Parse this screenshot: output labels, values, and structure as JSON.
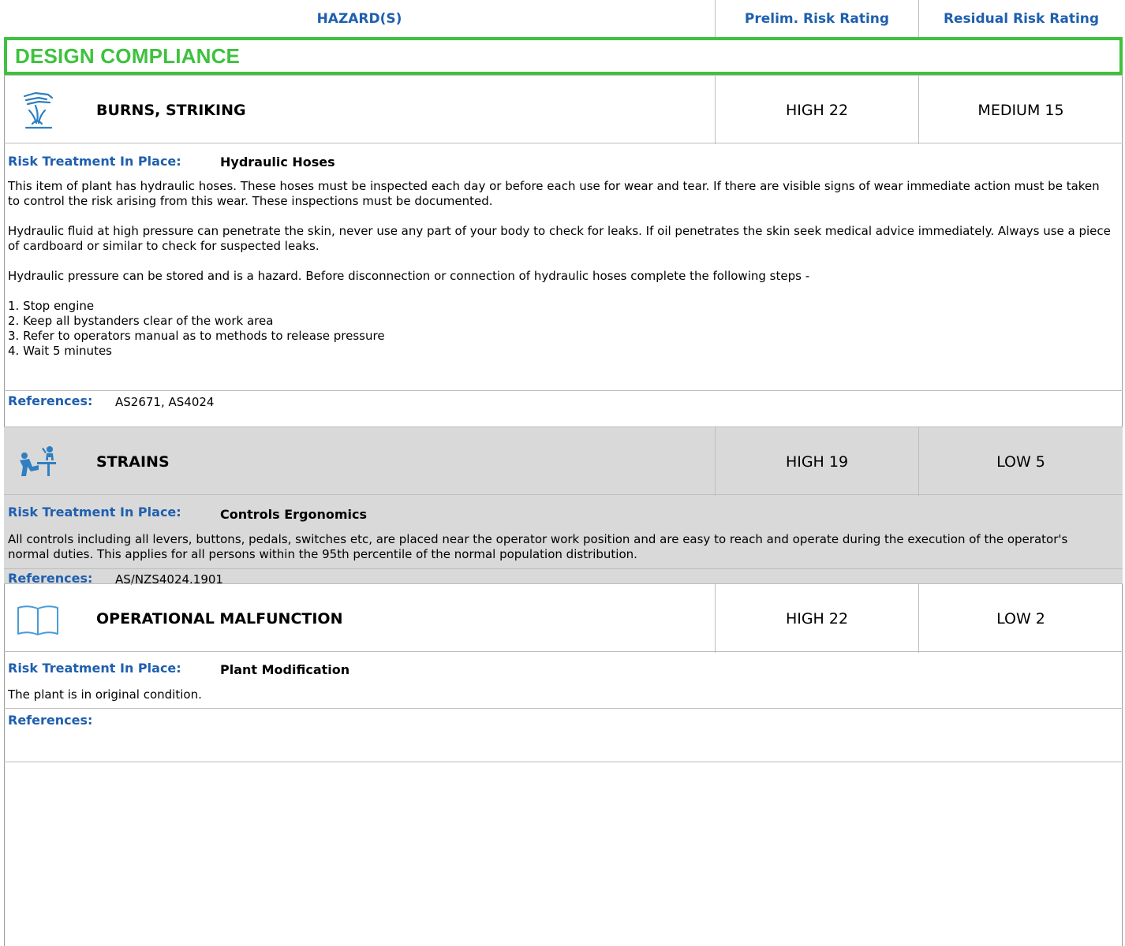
{
  "header": {
    "hazards": "HAZARD(S)",
    "prelim": "Prelim. Risk Rating",
    "residual": "Residual Risk Rating"
  },
  "section": {
    "title": "DESIGN COMPLIANCE"
  },
  "labels": {
    "risk_treatment": "Risk Treatment In Place:",
    "references": "References:"
  },
  "hazards": [
    {
      "icon": "burn-hand-icon",
      "name": "BURNS, STRIKING",
      "prelim": "HIGH 22",
      "residual": "MEDIUM 15",
      "treatment": "Hydraulic Hoses",
      "paragraphs": [
        "This item of plant has hydraulic hoses. These hoses must be inspected each day or before each use for wear and tear. If there are visible signs of wear immediate action must be taken to control the risk arising from this wear. These inspections must be documented.",
        "Hydraulic fluid at high pressure can penetrate the skin, never use any part of your body to check for leaks. If oil penetrates the skin seek medical advice immediately. Always use a piece of cardboard or similar to check for suspected leaks.",
        "Hydraulic pressure can be stored and is a hazard. Before disconnection or connection of hydraulic hoses complete the following steps -"
      ],
      "steps": [
        "1. Stop engine",
        "2. Keep all bystanders clear of the work area",
        "3. Refer to operators manual as to methods to release pressure",
        "4. Wait 5 minutes"
      ],
      "references": "AS2671, AS4024"
    },
    {
      "icon": "ergonomic-worker-icon",
      "name": "STRAINS",
      "prelim": "HIGH 19",
      "residual": "LOW 5",
      "treatment": "Controls Ergonomics",
      "paragraphs": [
        "All controls including all levers, buttons, pedals, switches etc, are placed near the operator work position and are easy to reach and operate during the execution of the operator's normal duties. This applies for all persons within the 95th percentile of the normal population distribution."
      ],
      "references": "AS/NZS4024.1901"
    },
    {
      "icon": "open-book-icon",
      "name": "OPERATIONAL MALFUNCTION",
      "prelim": "HIGH 22",
      "residual": "LOW 2",
      "treatment": "Plant Modification",
      "paragraphs": [
        "The plant is in original condition."
      ],
      "references": ""
    }
  ]
}
